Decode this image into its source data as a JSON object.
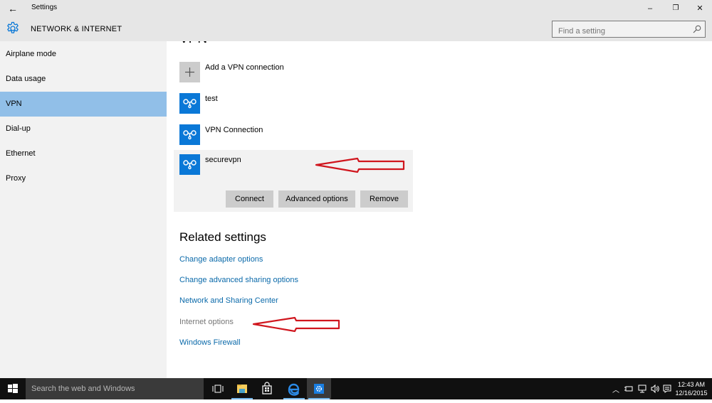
{
  "window": {
    "title": "Settings",
    "section_title": "NETWORK & INTERNET",
    "controls": {
      "minimize": "–",
      "restore": "❐",
      "close": "✕"
    },
    "back_icon": "←"
  },
  "search": {
    "placeholder": "Find a setting",
    "value": ""
  },
  "sidebar": {
    "items": [
      {
        "label": "Airplane mode",
        "selected": false
      },
      {
        "label": "Data usage",
        "selected": false
      },
      {
        "label": "VPN",
        "selected": true
      },
      {
        "label": "Dial-up",
        "selected": false
      },
      {
        "label": "Ethernet",
        "selected": false
      },
      {
        "label": "Proxy",
        "selected": false
      }
    ]
  },
  "main": {
    "heading": "VPN",
    "add_label": "Add a VPN connection",
    "connections": [
      {
        "name": "test"
      },
      {
        "name": "VPN Connection"
      },
      {
        "name": "securevpn",
        "selected": true
      }
    ],
    "actions": {
      "connect": "Connect",
      "advanced": "Advanced options",
      "remove": "Remove"
    },
    "related_heading": "Related settings",
    "related_links": [
      {
        "label": "Change adapter options",
        "style": "link"
      },
      {
        "label": "Change advanced sharing options",
        "style": "link"
      },
      {
        "label": "Network and Sharing Center",
        "style": "link"
      },
      {
        "label": "Internet options",
        "style": "gray"
      },
      {
        "label": "Windows Firewall",
        "style": "link"
      }
    ],
    "annotation_color": "#d0161e"
  },
  "colors": {
    "accent": "#0a78d7",
    "selected_nav": "#91bfe8",
    "link": "#0b6aaa"
  },
  "taskbar": {
    "search_placeholder": "Search the web and Windows",
    "clock_time": "12:43 AM",
    "clock_date": "12/16/2015"
  }
}
